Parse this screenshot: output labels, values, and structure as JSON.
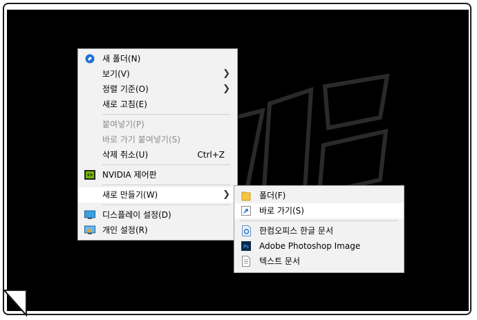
{
  "context_menu": {
    "items": [
      {
        "label": "새 폴더(N)"
      },
      {
        "label": "보기(V)"
      },
      {
        "label": "정렬 기준(O)"
      },
      {
        "label": "새로 고침(E)"
      },
      {
        "label": "붙여넣기(P)"
      },
      {
        "label": "바로 가기 붙여넣기(S)"
      },
      {
        "label": "삭제 취소(U)",
        "shortcut": "Ctrl+Z"
      },
      {
        "label": "NVIDIA 제어판"
      },
      {
        "label": "새로 만들기(W)"
      },
      {
        "label": "디스플레이 설정(D)"
      },
      {
        "label": "개인 설정(R)"
      }
    ]
  },
  "submenu": {
    "items": [
      {
        "label": "폴더(F)"
      },
      {
        "label": "바로 가기(S)"
      },
      {
        "label": "한컴오피스 한글 문서"
      },
      {
        "label": "Adobe Photoshop Image"
      },
      {
        "label": "텍스트 문서"
      }
    ]
  },
  "colors": {
    "desktop": "#000000",
    "menu_bg": "#f2f2f2",
    "hover_bg": "#ffffff",
    "disabled_text": "#8c8c8c"
  }
}
